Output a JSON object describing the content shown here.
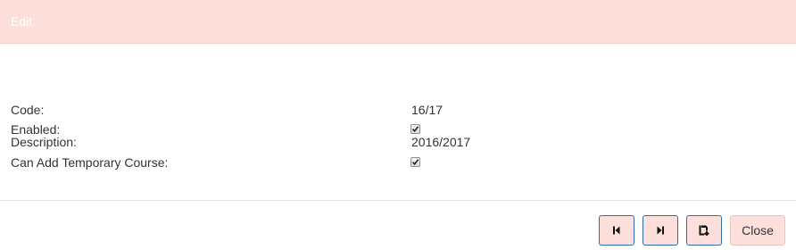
{
  "dialog": {
    "title": "Edit"
  },
  "fields": {
    "code": {
      "label": "Code:",
      "value": "16/17"
    },
    "description": {
      "label": "Description:",
      "value": "2016/2017"
    },
    "enabled": {
      "label": "Enabled:",
      "checked": true
    },
    "can_add_temporary_course": {
      "label": "Can Add Temporary Course:",
      "checked": true
    }
  },
  "footer": {
    "close_label": "Close",
    "buttons": [
      "first-record-icon",
      "next-record-icon",
      "save-record-icon"
    ]
  },
  "colors": {
    "header_bg": "#fde0dc",
    "button_border": "#2e6da4"
  }
}
